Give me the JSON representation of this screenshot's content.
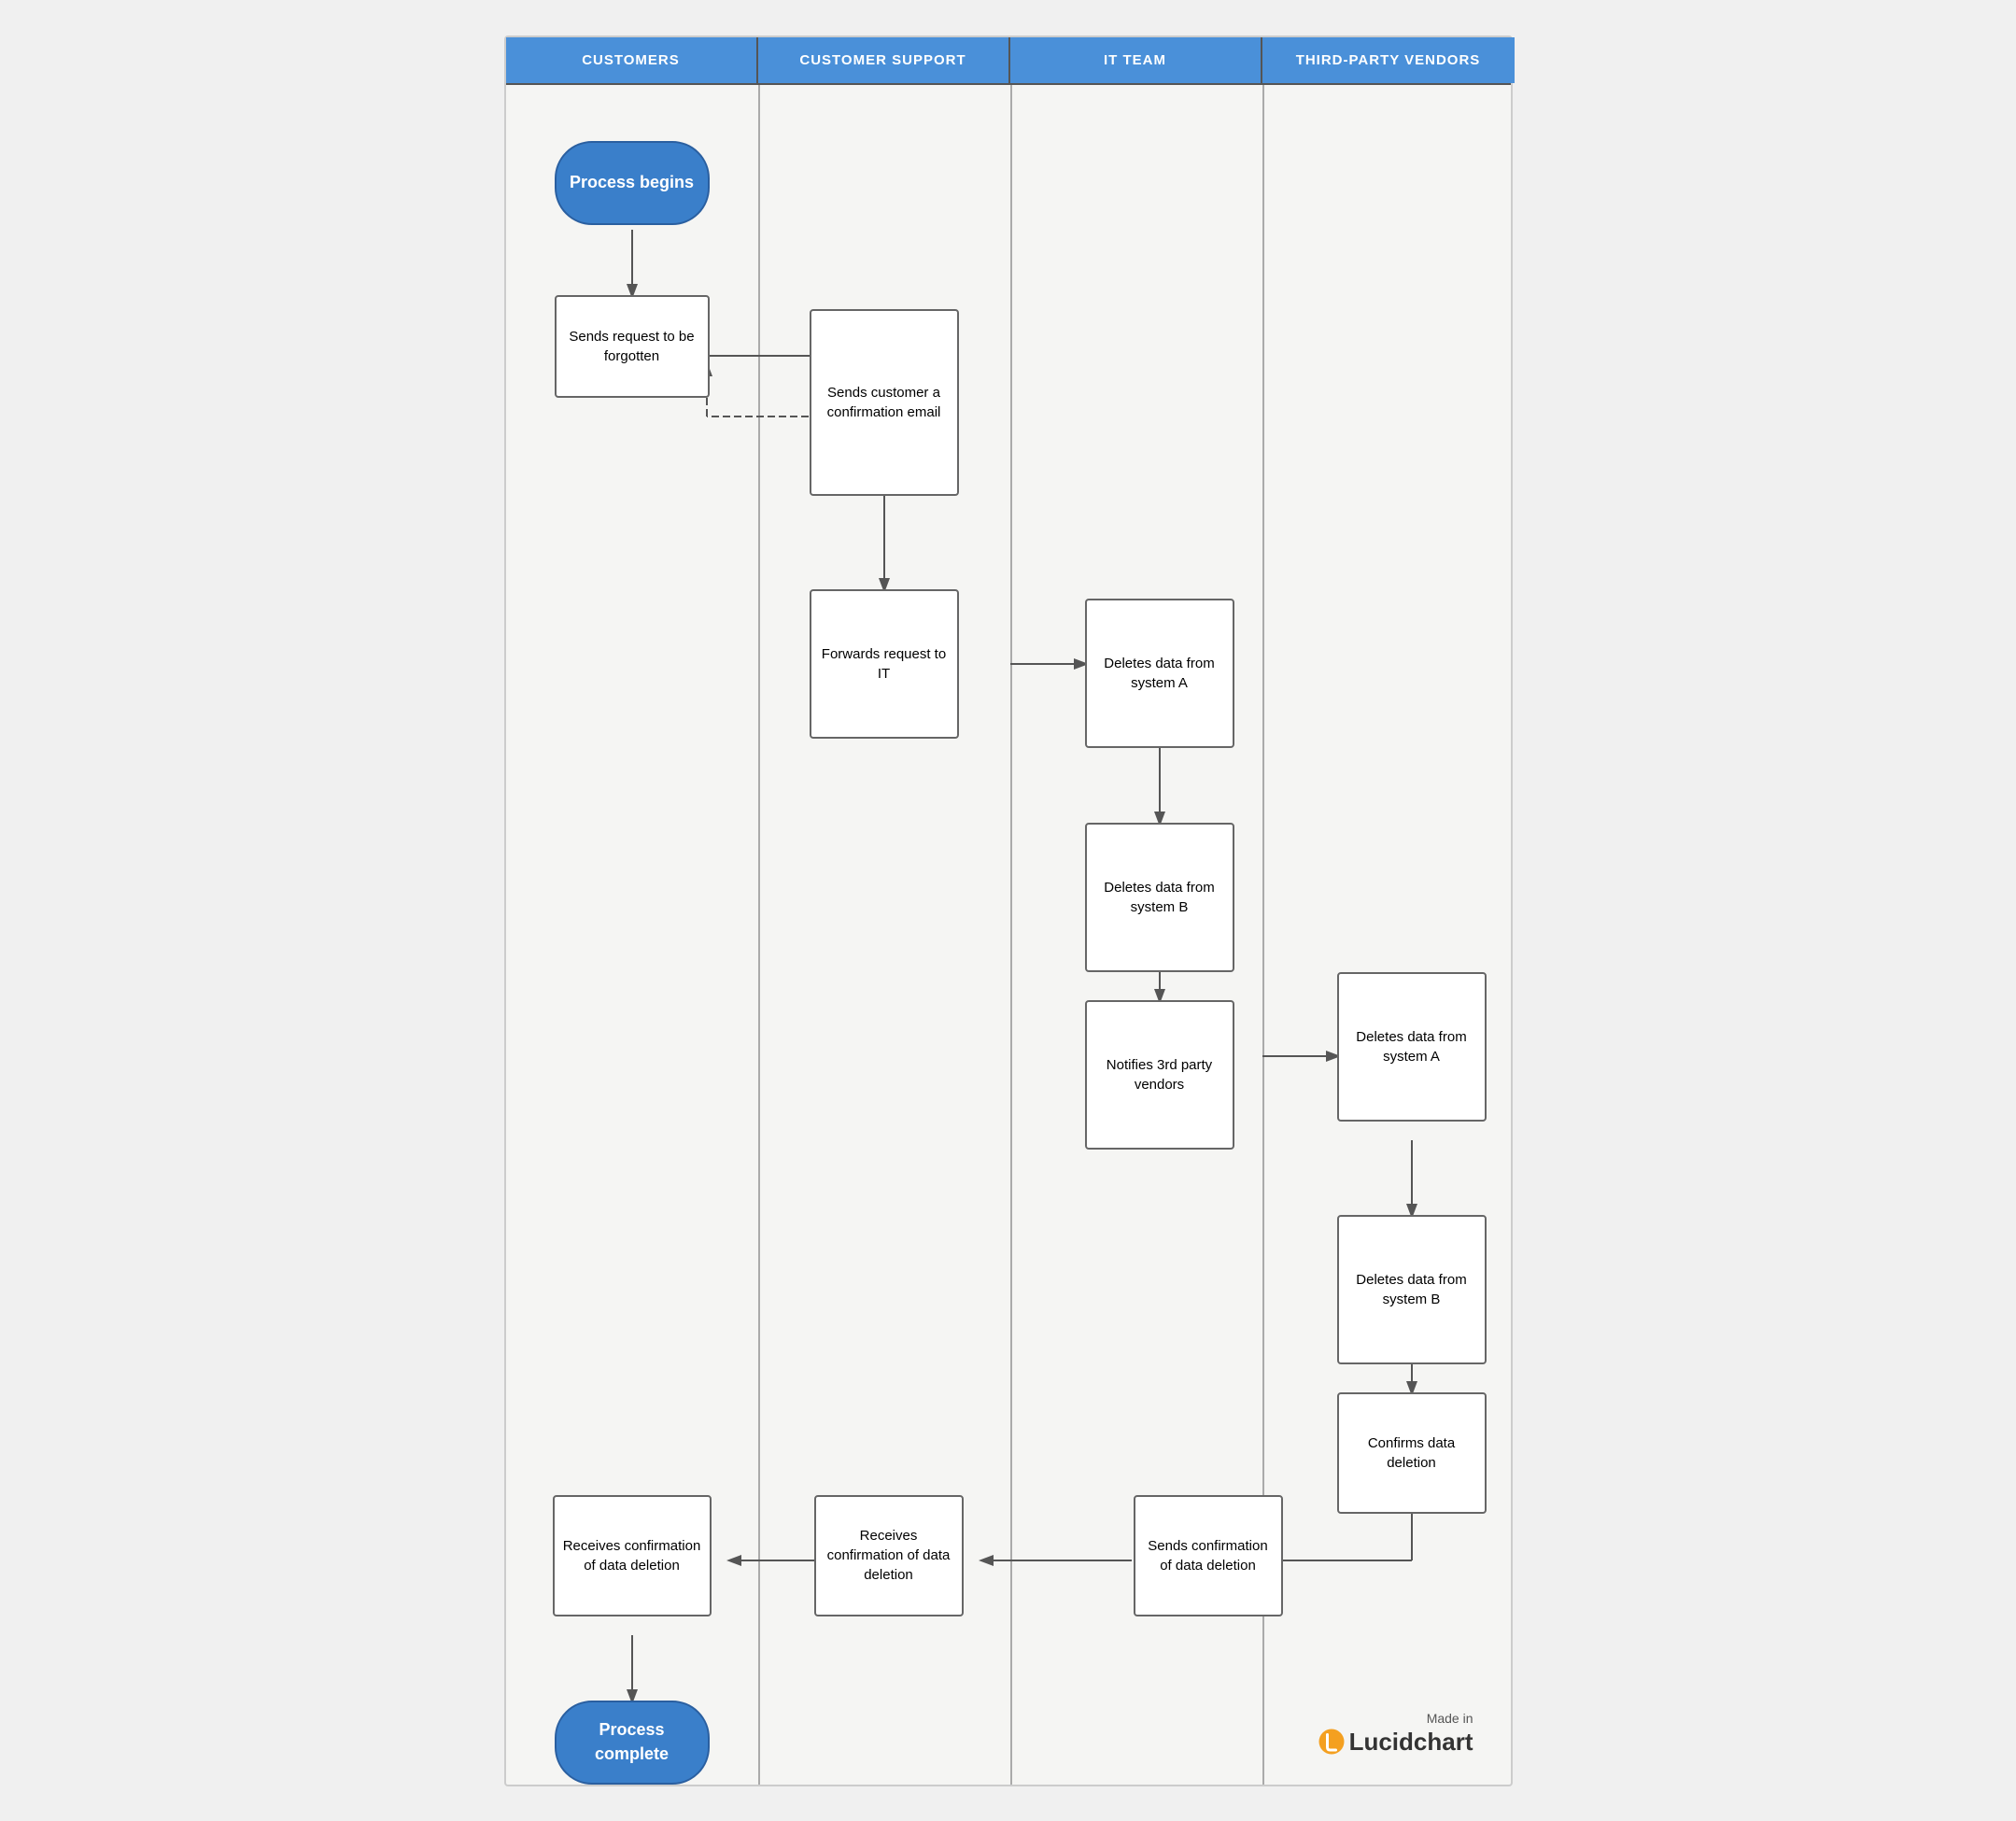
{
  "header": {
    "columns": [
      "CUSTOMERS",
      "CUSTOMER SUPPORT",
      "IT TEAM",
      "THIRD-PARTY VENDORS"
    ]
  },
  "nodes": {
    "process_begins": "Process begins",
    "sends_request": "Sends request to be forgotten",
    "sends_confirmation_email": "Sends customer a confirmation email",
    "forwards_request": "Forwards request to IT",
    "deletes_A_it": "Deletes data from system A",
    "deletes_B_it": "Deletes data from system B",
    "notifies_vendors": "Notifies 3rd party vendors",
    "deletes_A_vendor": "Deletes data from system A",
    "deletes_B_vendor": "Deletes data from system B",
    "confirms_deletion": "Confirms data deletion",
    "sends_confirmation": "Sends confirmation of data deletion",
    "receives_confirmation_support": "Receives confirmation of data deletion",
    "receives_confirmation_customer": "Receives confirmation of data deletion",
    "process_complete": "Process complete"
  },
  "logo": {
    "made_in": "Made in",
    "brand": "Lucidchart"
  }
}
